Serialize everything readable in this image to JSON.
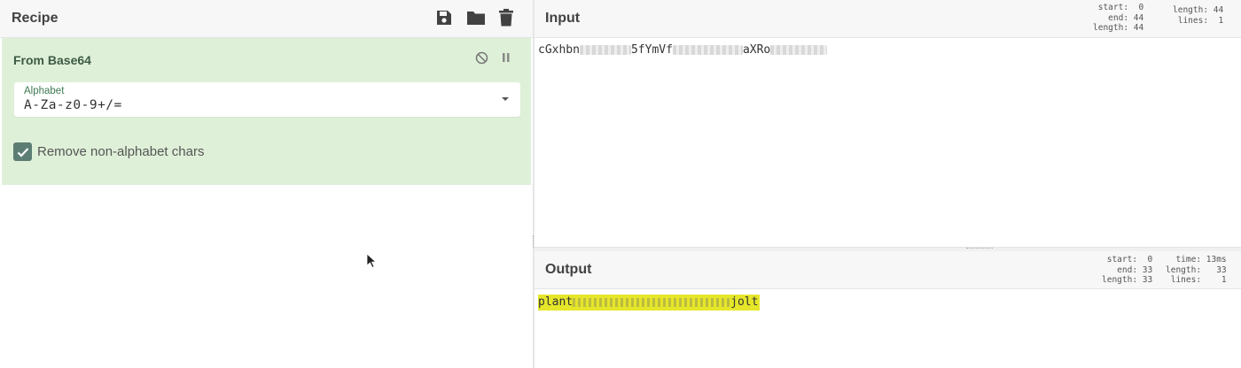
{
  "recipe": {
    "title": "Recipe",
    "toolbar_icons": [
      "save-icon",
      "folder-icon",
      "trash-icon"
    ],
    "operation": {
      "name": "From Base64",
      "controls": [
        "disable-icon",
        "pause-icon"
      ],
      "alphabet_label": "Alphabet",
      "alphabet_value": "A-Za-z0-9+/=",
      "remove_nonalphabet_label": "Remove non-alphabet chars",
      "remove_nonalphabet_checked": true,
      "card_color": "#dff0d8"
    }
  },
  "input": {
    "title": "Input",
    "stats_left": "start:  0\n  end: 44\nlength: 44",
    "stats_right": "length: 44\n lines:  1",
    "text_parts": [
      "cGxhbn",
      "5fYmVf",
      "aXRo"
    ]
  },
  "output": {
    "title": "Output",
    "stats_left": "start:  0\n  end: 33\nlength: 33",
    "stats_right": "  time: 13ms\nlength:   33\n lines:    1",
    "text_parts": [
      "plant",
      "jolt"
    ],
    "highlight_color": "#e6e62a"
  }
}
